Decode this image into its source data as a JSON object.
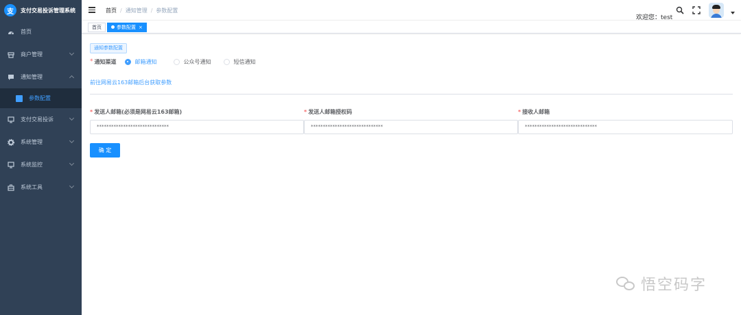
{
  "app": {
    "title": "支付交易投诉管理系统",
    "logo_char": "支"
  },
  "sidebar": {
    "items": [
      {
        "label": "首页",
        "icon": "dashboard-icon",
        "expandable": false
      },
      {
        "label": "商户管理",
        "icon": "merchant-icon",
        "expandable": true
      },
      {
        "label": "通知管理",
        "icon": "message-icon",
        "expandable": true,
        "expanded": true
      },
      {
        "label": "支付交易投诉",
        "icon": "monitor-icon",
        "expandable": true
      },
      {
        "label": "系统管理",
        "icon": "gear-icon",
        "expandable": true
      },
      {
        "label": "系统监控",
        "icon": "monitor-icon",
        "expandable": true
      },
      {
        "label": "系统工具",
        "icon": "toolbox-icon",
        "expandable": true
      }
    ],
    "subitem": {
      "label": "参数配置",
      "icon": "document-icon"
    }
  },
  "header": {
    "breadcrumb": [
      "首页",
      "通知管理",
      "参数配置"
    ],
    "welcome": "欢迎您：test"
  },
  "tags": {
    "home": "首页",
    "active": "参数配置",
    "close": "×"
  },
  "form": {
    "section_label": "通知参数配置",
    "channel_label": "通知渠道",
    "channels": [
      {
        "label": "邮箱通知",
        "checked": true
      },
      {
        "label": "公众号通知",
        "checked": false
      },
      {
        "label": "短信通知",
        "checked": false
      }
    ],
    "link_text": "前往网易云163邮箱后台获取参数",
    "fields": [
      {
        "label": "发送人邮箱(必须是网易云163邮箱)",
        "value": "******************************"
      },
      {
        "label": "发送人邮箱授权码",
        "value": "******************************"
      },
      {
        "label": "接收人邮箱",
        "value": "******************************"
      }
    ],
    "confirm": "确 定"
  },
  "watermark": {
    "text": "悟空码字"
  },
  "colors": {
    "sidebar_bg": "#304156",
    "primary": "#1890ff",
    "required": "#f56c6c"
  }
}
